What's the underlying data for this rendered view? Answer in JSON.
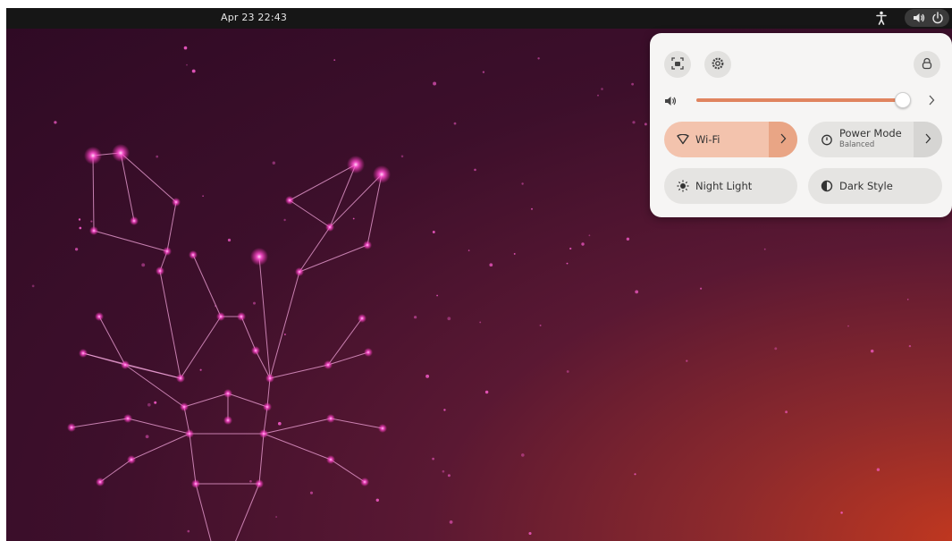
{
  "top_bar": {
    "clock": "Apr 23  22:43",
    "icons": [
      "accessibility-icon",
      "volume-icon",
      "power-icon"
    ]
  },
  "quick_settings": {
    "top_buttons": [
      "screenshot-icon",
      "settings-gear-icon",
      "lock-icon"
    ],
    "volume": {
      "level": 0.98,
      "icon": "volume-icon",
      "menu_icon": "chevron-right-icon"
    },
    "tiles": [
      {
        "label": "Wi-Fi",
        "sublabel": "",
        "icon": "wifi-icon",
        "active": true,
        "has_menu": true
      },
      {
        "label": "Power Mode",
        "sublabel": "Balanced",
        "icon": "power-mode-icon",
        "active": false,
        "has_menu": true
      },
      {
        "label": "Night Light",
        "sublabel": "",
        "icon": "night-light-icon",
        "active": false,
        "has_menu": false
      },
      {
        "label": "Dark Style",
        "sublabel": "",
        "icon": "dark-style-icon",
        "active": false,
        "has_menu": false
      }
    ]
  },
  "colors": {
    "top_bar": "#161616",
    "accent": "#e0845f",
    "panel": "#f6f5f4",
    "active_tile": "#f3c3ad",
    "tile": "#e5e4e2",
    "constellation": "#ff3fc8"
  },
  "wallpaper": {
    "subject": "lobster-constellation"
  }
}
